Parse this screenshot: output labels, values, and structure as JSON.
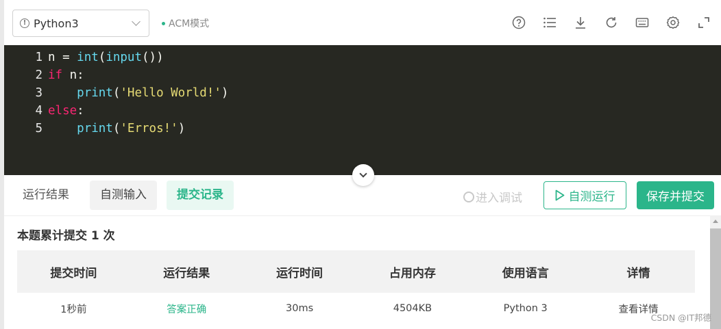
{
  "toolbar": {
    "language": "Python3",
    "mode_label": "ACM模式",
    "icons": [
      "help-icon",
      "list-icon",
      "download-icon",
      "refresh-icon",
      "keyboard-icon",
      "settings-icon",
      "fullscreen-icon"
    ]
  },
  "editor": {
    "lines": [
      {
        "num": "1",
        "tokens": [
          [
            "cd",
            "n = "
          ],
          [
            "fn",
            "int"
          ],
          [
            "cd",
            "("
          ],
          [
            "fn",
            "input"
          ],
          [
            "cd",
            "())"
          ]
        ]
      },
      {
        "num": "2",
        "tokens": [
          [
            "kw",
            "if"
          ],
          [
            "cd",
            " n:"
          ]
        ]
      },
      {
        "num": "3",
        "tokens": [
          [
            "cd",
            "    "
          ],
          [
            "fn",
            "print"
          ],
          [
            "cd",
            "("
          ],
          [
            "st",
            "'Hello World!'"
          ],
          [
            "cd",
            ")"
          ]
        ]
      },
      {
        "num": "4",
        "tokens": [
          [
            "kw",
            "else"
          ],
          [
            "cd",
            ":"
          ]
        ]
      },
      {
        "num": "5",
        "tokens": [
          [
            "cd",
            "    "
          ],
          [
            "fn",
            "print"
          ],
          [
            "cd",
            "("
          ],
          [
            "st",
            "'Erros!'"
          ],
          [
            "cd",
            ")"
          ]
        ]
      }
    ]
  },
  "actions": {
    "tab_result": "运行结果",
    "tab_input": "自测输入",
    "tab_record": "提交记录",
    "debug": "进入调试",
    "run": "自测运行",
    "submit": "保存并提交"
  },
  "results": {
    "summary": "本题累计提交 1 次",
    "headers": [
      "提交时间",
      "运行结果",
      "运行时间",
      "占用内存",
      "使用语言",
      "详情"
    ],
    "rows": [
      {
        "time": "1秒前",
        "result": "答案正确",
        "runtime": "30ms",
        "memory": "4504KB",
        "language": "Python 3",
        "detail": "查看详情"
      }
    ]
  },
  "watermark": "CSDN @IT邦德",
  "colors": {
    "accent": "#2bb58a",
    "editor_bg": "#272822"
  }
}
